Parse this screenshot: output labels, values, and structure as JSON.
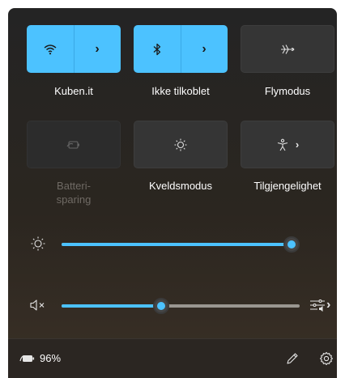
{
  "tiles": [
    {
      "label": "Kuben.it",
      "icon": "wifi-icon",
      "state": "active"
    },
    {
      "label": "Ikke tilkoblet",
      "icon": "bluetooth-icon",
      "state": "active"
    },
    {
      "label": "Flymodus",
      "icon": "airplane-icon",
      "state": "inactive"
    },
    {
      "label": "Batteri-\nsparing",
      "icon": "battery-saver-icon",
      "state": "disabled"
    },
    {
      "label": "Kveldsmodus",
      "icon": "night-light-icon",
      "state": "inactive"
    },
    {
      "label": "Tilgjengelighet",
      "icon": "accessibility-icon",
      "state": "inactive"
    }
  ],
  "sliders": {
    "brightness": {
      "icon": "brightness-icon",
      "value": 1.0
    },
    "volume": {
      "icon": "speaker-muted-icon",
      "value": 0.42,
      "output_icon": "audio-output-icon"
    }
  },
  "footer": {
    "battery_icon": "battery-charging-icon",
    "battery_percent": "96%",
    "edit_icon": "pencil-icon",
    "settings_icon": "gear-icon"
  },
  "colors": {
    "accent": "#4cc2ff"
  }
}
